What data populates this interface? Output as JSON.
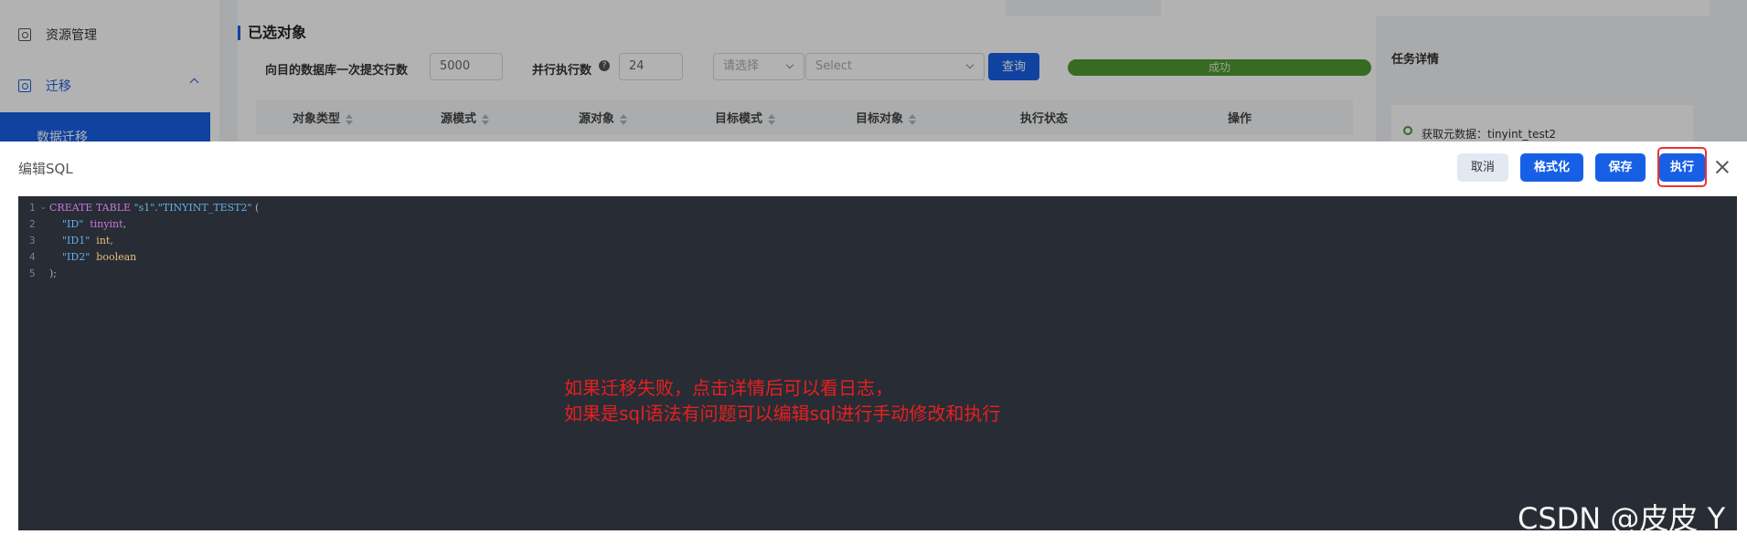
{
  "sidebar": {
    "items": [
      {
        "label": "资源管理",
        "icon": "resource-icon"
      },
      {
        "label": "迁移",
        "icon": "migrate-icon"
      }
    ],
    "sub_item": "数据迁移"
  },
  "section": {
    "title": "已选对象",
    "batch_label": "向目的数据库一次提交行数",
    "batch_value": "5000",
    "parallel_label": "并行执行数",
    "parallel_value": "24",
    "select1_placeholder": "请选择",
    "select2_placeholder": "Select",
    "query_button": "查询",
    "progress_text": "成功",
    "progress_fraction": 1.0,
    "progress_color": "#4f9a34"
  },
  "table": {
    "columns": [
      "对象类型",
      "源模式",
      "源对象",
      "目标模式",
      "目标对象",
      "执行状态",
      "操作"
    ]
  },
  "task_detail": {
    "title": "任务详情",
    "item": "获取元数据：tinyint_test2"
  },
  "dialog": {
    "title": "编辑SQL",
    "cancel": "取消",
    "format": "格式化",
    "save": "保存",
    "execute": "执行",
    "highlight_color": "#e33"
  },
  "editor": {
    "line_numbers": [
      "1",
      "2",
      "3",
      "4",
      "5"
    ],
    "lines": [
      [
        {
          "t": "CREATE TABLE ",
          "c": "kw"
        },
        {
          "t": "\"s1\"",
          "c": "str"
        },
        {
          "t": ".",
          "c": ""
        },
        {
          "t": "\"TINYINT_TEST2\"",
          "c": "str"
        },
        {
          "t": " (",
          "c": ""
        }
      ],
      [
        {
          "t": "    ",
          "c": ""
        },
        {
          "t": "\"ID\"",
          "c": "str"
        },
        {
          "t": "  ",
          "c": ""
        },
        {
          "t": "tinyint",
          "c": "kw"
        },
        {
          "t": ",",
          "c": ""
        }
      ],
      [
        {
          "t": "    ",
          "c": ""
        },
        {
          "t": "\"ID1\"",
          "c": "str"
        },
        {
          "t": "  ",
          "c": ""
        },
        {
          "t": "int",
          "c": "typ"
        },
        {
          "t": ",",
          "c": ""
        }
      ],
      [
        {
          "t": "    ",
          "c": ""
        },
        {
          "t": "\"ID2\"",
          "c": "str"
        },
        {
          "t": "  ",
          "c": ""
        },
        {
          "t": "boolean",
          "c": "typ"
        }
      ],
      [
        {
          "t": ");",
          "c": ""
        }
      ]
    ]
  },
  "annotation": {
    "line1": "如果迁移失败，点击详情后可以看日志，",
    "line2": "如果是sql语法有问题可以编辑sql进行手动修改和执行",
    "color": "#e62020"
  },
  "watermark": "CSDN @皮皮 Y"
}
